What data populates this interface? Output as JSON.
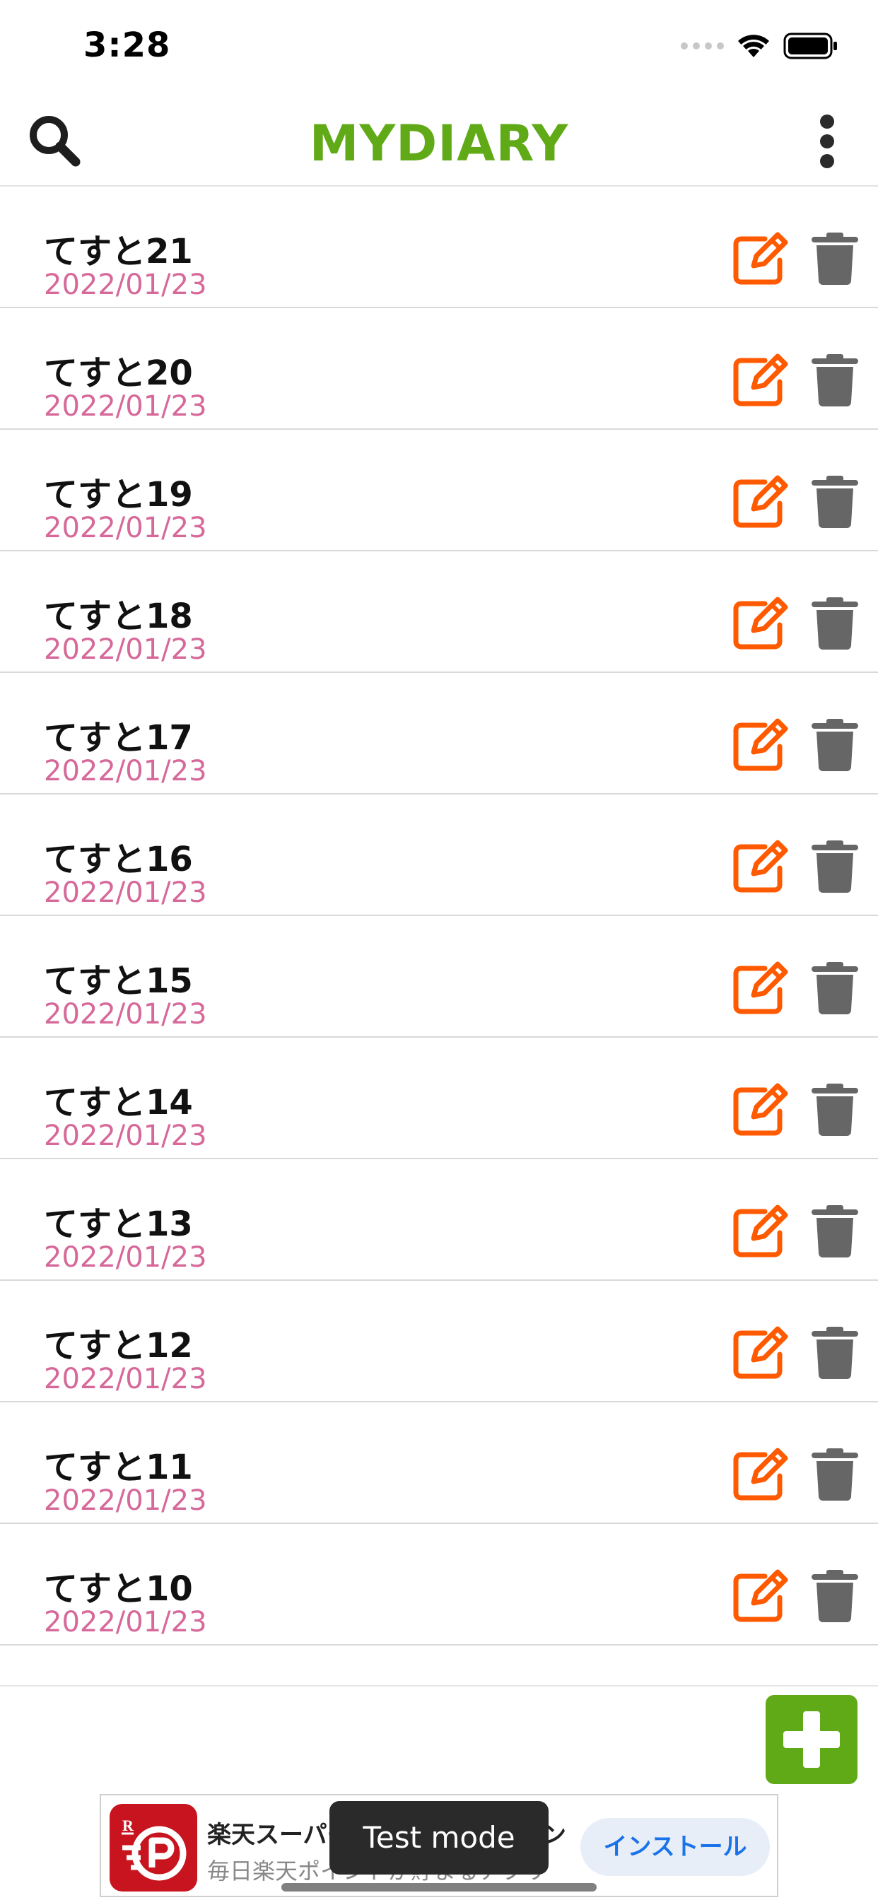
{
  "status_bar": {
    "time": "3:28"
  },
  "header": {
    "title": "MYDIARY",
    "title_color": "#5faa16",
    "search_icon": "magnifier-icon",
    "menu_icon": "vertical-ellipsis-icon"
  },
  "entries": [
    {
      "title": "てすと21",
      "date": "2022/01/23"
    },
    {
      "title": "てすと20",
      "date": "2022/01/23"
    },
    {
      "title": "てすと19",
      "date": "2022/01/23"
    },
    {
      "title": "てすと18",
      "date": "2022/01/23"
    },
    {
      "title": "てすと17",
      "date": "2022/01/23"
    },
    {
      "title": "てすと16",
      "date": "2022/01/23"
    },
    {
      "title": "てすと15",
      "date": "2022/01/23"
    },
    {
      "title": "てすと14",
      "date": "2022/01/23"
    },
    {
      "title": "てすと13",
      "date": "2022/01/23"
    },
    {
      "title": "てすと12",
      "date": "2022/01/23"
    },
    {
      "title": "てすと11",
      "date": "2022/01/23"
    },
    {
      "title": "てすと10",
      "date": "2022/01/23"
    }
  ],
  "row_icons": {
    "edit": "edit-square-pencil-icon",
    "delete": "trash-can-icon"
  },
  "colors": {
    "edit": "#ff5a00",
    "delete": "#666666",
    "date": "#d6699a",
    "add_button": "#5faa16"
  },
  "fab": {
    "icon": "plus-icon"
  },
  "ad": {
    "title": "楽天スーパーポイントスクリーン",
    "subtitle": "毎日楽天ポイントが貯まるアプリ",
    "install_label": "インストール",
    "test_mode_label": "Test mode"
  }
}
